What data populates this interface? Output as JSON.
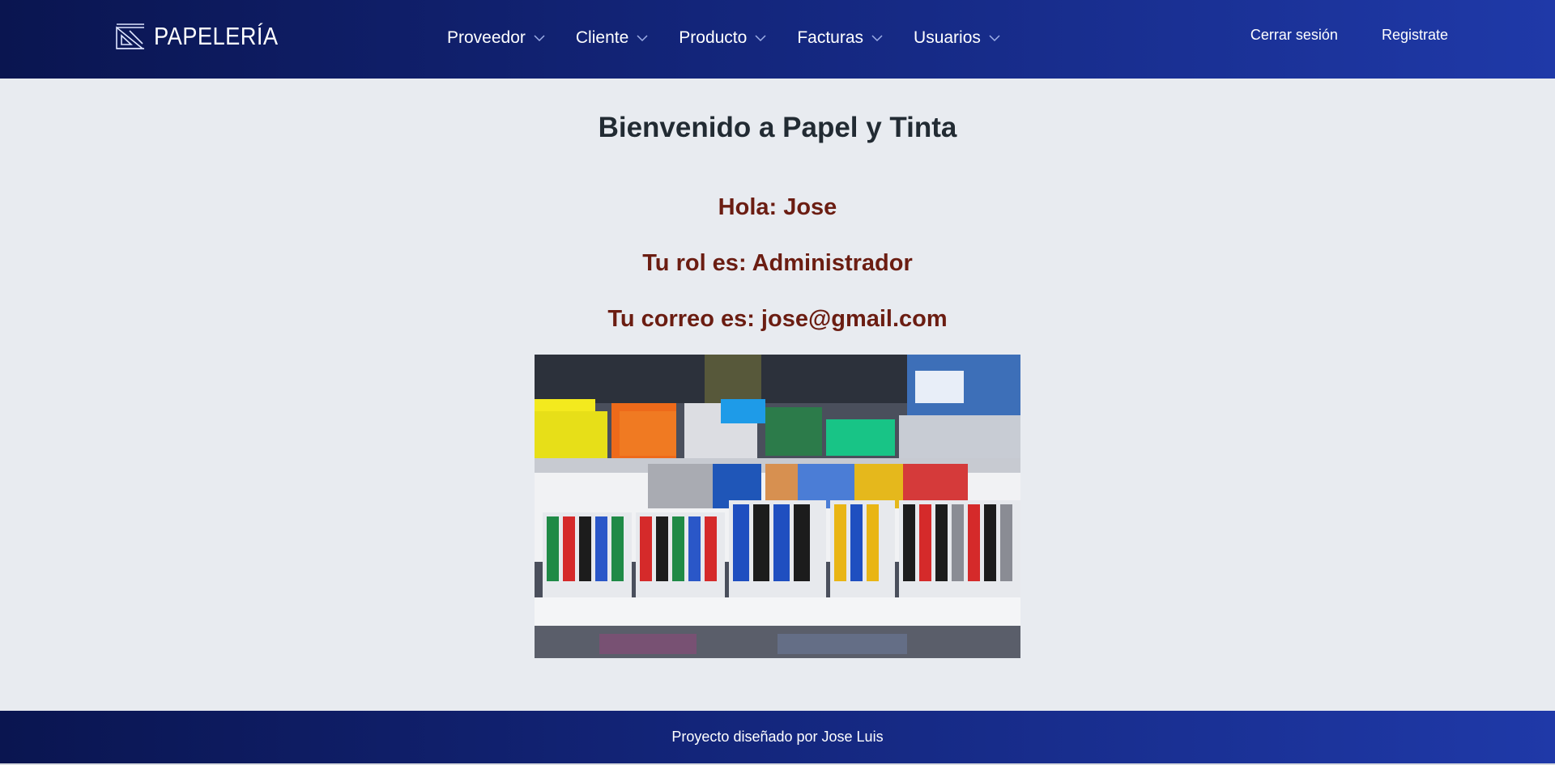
{
  "header": {
    "brand": "PAPELERÍA",
    "menu": [
      {
        "label": "Proveedor"
      },
      {
        "label": "Cliente"
      },
      {
        "label": "Producto"
      },
      {
        "label": "Facturas"
      },
      {
        "label": "Usuarios"
      }
    ],
    "logout": "Cerrar sesión",
    "register": "Registrate"
  },
  "main": {
    "title": "Bienvenido a Papel y Tinta",
    "greeting": "Hola: Jose",
    "role": "Tu rol es: Administrador",
    "email": "Tu correo es: jose@gmail.com"
  },
  "footer": {
    "text": "Proyecto diseñado por Jose Luis"
  },
  "icons": {
    "logo": "ruler-triangle-icon",
    "dropdown": "chevron-down-icon"
  },
  "colors": {
    "navbar_start": "#0a1550",
    "navbar_end": "#1f39a8",
    "background": "#e8ebf0",
    "heading": "#222b33",
    "info_text": "#6b1d12"
  }
}
